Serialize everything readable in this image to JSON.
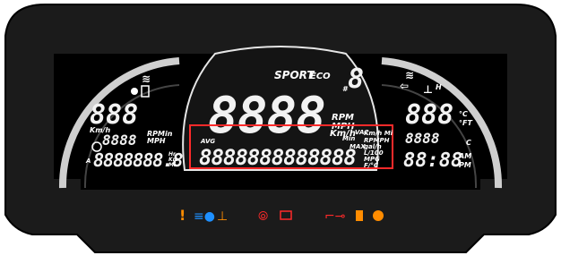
{
  "labels": {
    "sport": "SPORT",
    "eco": "ECO",
    "rpm": "RPM",
    "mph": "MPH",
    "kmh_center": "Km/h",
    "avg": "AVG",
    "min": "Min",
    "max": "MAX",
    "vac": "VAC",
    "units_right_block": [
      "Km/h Mi",
      "RPMPH",
      "gal/h",
      "L/100",
      "MPG",
      "F/°C"
    ],
    "left_kmh": "Km/h",
    "left_rpmmin": "RPMin",
    "left_mph": "MPH",
    "left_odo": "8888888.8",
    "left_hr_km_mi": [
      "Hr",
      "Km",
      "Mi"
    ],
    "left_a": "A",
    "right_c_top": "°C",
    "right_ft": "°FT",
    "right_h": "H",
    "right_c_low": "C",
    "clock": "88:88",
    "am": "AM",
    "pm": "PM"
  },
  "digits": {
    "center_main": "8888",
    "left_top": "888",
    "left_mid": "888",
    "left_small": "8888",
    "right_top": "888",
    "right_mid": "8888",
    "center_row": "8888888888888",
    "gear": "8"
  },
  "indicators": [
    {
      "name": "warning-exclamation-icon",
      "color": "#ff8c00"
    },
    {
      "name": "high-beam-icon",
      "color": "#1e90ff"
    },
    {
      "name": "coolant-temp-icon",
      "color": "#ff8c00"
    },
    {
      "name": "brake-icon",
      "color": "#ff2a2a"
    },
    {
      "name": "battery-icon",
      "color": "#ff2a2a"
    },
    {
      "name": "oil-pressure-icon",
      "color": "#ff2a2a"
    },
    {
      "name": "fuel-low-icon",
      "color": "#ff8c00"
    },
    {
      "name": "check-engine-icon",
      "color": "#ff8c00"
    }
  ],
  "colors": {
    "panel": "#1b1b1b",
    "lcd": "#000000",
    "highlight": "#ff2a2a"
  }
}
